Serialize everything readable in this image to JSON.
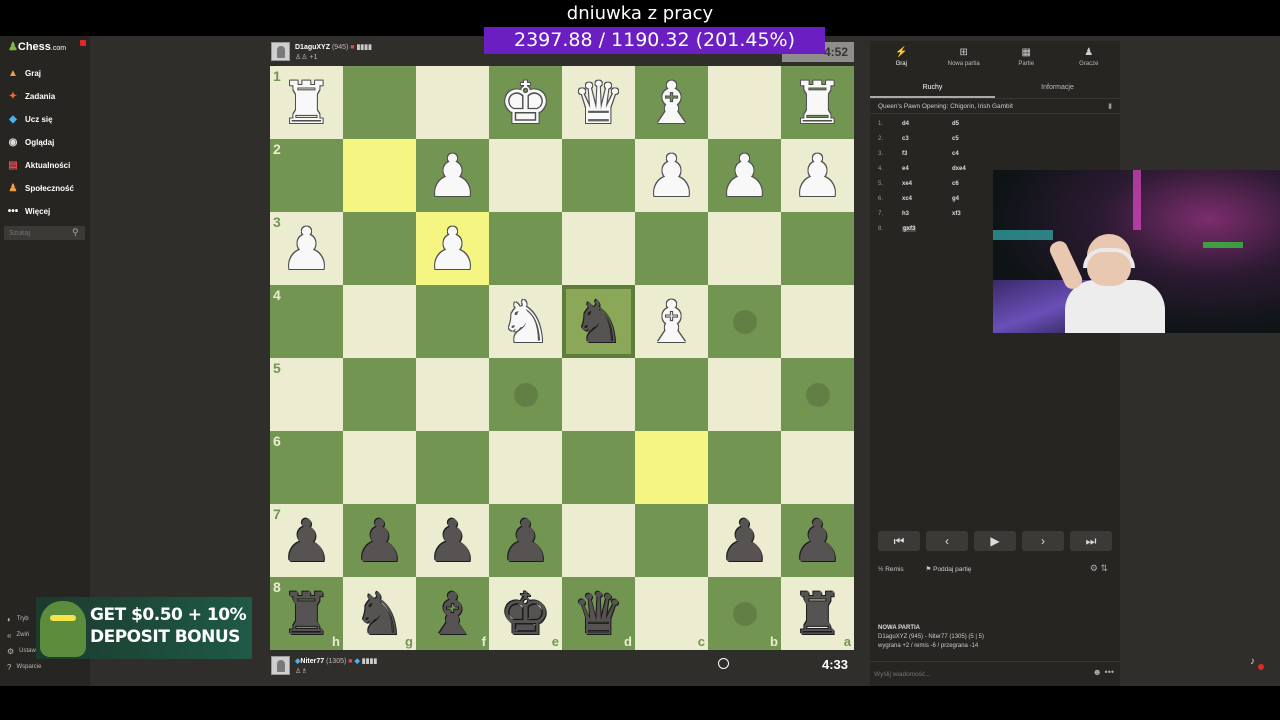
{
  "overlay": {
    "title": "dniuwka z pracy",
    "money": "2397.88 / 1190.32 (201.45%)"
  },
  "sidebar": {
    "logo_prefix": "Chess",
    "logo_suffix": ".com",
    "items": [
      {
        "label": "Graj",
        "icon": "play-icon"
      },
      {
        "label": "Zadania",
        "icon": "puzzle-icon"
      },
      {
        "label": "Ucz się",
        "icon": "learn-icon"
      },
      {
        "label": "Oglądaj",
        "icon": "watch-icon"
      },
      {
        "label": "Aktualności",
        "icon": "news-icon"
      },
      {
        "label": "Społeczność",
        "icon": "community-icon"
      },
      {
        "label": "Więcej",
        "icon": "more-icon"
      }
    ],
    "search_placeholder": "Szukaj",
    "bottom": [
      {
        "label": "Tryb",
        "icon": "theme-icon"
      },
      {
        "label": "Zwiń",
        "icon": "collapse-icon"
      },
      {
        "label": "Ustaw",
        "icon": "settings-icon"
      },
      {
        "label": "Wsparcie",
        "icon": "help-icon"
      }
    ]
  },
  "ad": {
    "line1": "GET $0.50 + 10%",
    "line2": "DEPOSIT BONUS"
  },
  "top_player": {
    "name": "D1aguXYZ",
    "rating": "(945)",
    "sub": "+1",
    "clock": "4:52"
  },
  "bottom_player": {
    "name": "Niter77",
    "rating": "(1305)",
    "clock": "4:33"
  },
  "board": {
    "rows": [
      [
        "wR",
        "",
        "",
        "wK",
        "wQ",
        "wB",
        "",
        "wR"
      ],
      [
        "",
        "",
        "wP",
        "",
        "",
        "wP",
        "wP",
        "wP"
      ],
      [
        "wP",
        "",
        "wP",
        "",
        "",
        "",
        "",
        ""
      ],
      [
        "",
        "",
        "",
        "wN",
        "bN",
        "wB",
        "dot",
        ""
      ],
      [
        "",
        "",
        "",
        "dot",
        "",
        "",
        "",
        "dot"
      ],
      [
        "",
        "",
        "",
        "",
        "",
        "",
        "",
        ""
      ],
      [
        "bP",
        "bP",
        "bP",
        "bP",
        "",
        "",
        "bP",
        "bP"
      ],
      [
        "bR",
        "bN",
        "bB",
        "bK",
        "bQ",
        "",
        "dot",
        "bR"
      ]
    ],
    "ranks": [
      "1",
      "2",
      "3",
      "4",
      "5",
      "6",
      "7",
      "8"
    ],
    "files": [
      "h",
      "g",
      "f",
      "e",
      "d",
      "c",
      "b",
      "a"
    ],
    "highlights": [
      "1-1",
      "2-2",
      "5-5"
    ],
    "selected": "3-4"
  },
  "panel": {
    "tabs": [
      {
        "label": "Graj",
        "icon": "play-icon"
      },
      {
        "label": "Nowa partia",
        "icon": "plus-icon"
      },
      {
        "label": "Partie",
        "icon": "games-icon"
      },
      {
        "label": "Gracze",
        "icon": "players-icon"
      }
    ],
    "subtabs": [
      "Ruchy",
      "Informacje"
    ],
    "opening": "Queen's Pawn Opening: Chigorin, Irish Gambit",
    "moves": [
      {
        "n": "1.",
        "w": "d4",
        "b": "d5"
      },
      {
        "n": "2.",
        "w": "c3",
        "b": "c5"
      },
      {
        "n": "3.",
        "w": "f3",
        "b": "c4"
      },
      {
        "n": "4.",
        "w": "e4",
        "b": "dxe4"
      },
      {
        "n": "5.",
        "w": "xe4",
        "b": "c6"
      },
      {
        "n": "6.",
        "w": "xc4",
        "b": "g4"
      },
      {
        "n": "7.",
        "w": "h3",
        "b": "xf3"
      },
      {
        "n": "8.",
        "w": "gxf3",
        "b": ""
      }
    ],
    "draw": "Remis",
    "resign": "Poddaj partię",
    "newgame_title": "NOWA PARTIA",
    "newgame_players": "D1aguXYZ (945) - Niter77 (1305) (5 | 5)",
    "newgame_stats": "wygrana +2 / remis -6 / przegrana -14",
    "chat_placeholder": "Wyślij wiadomość..."
  }
}
